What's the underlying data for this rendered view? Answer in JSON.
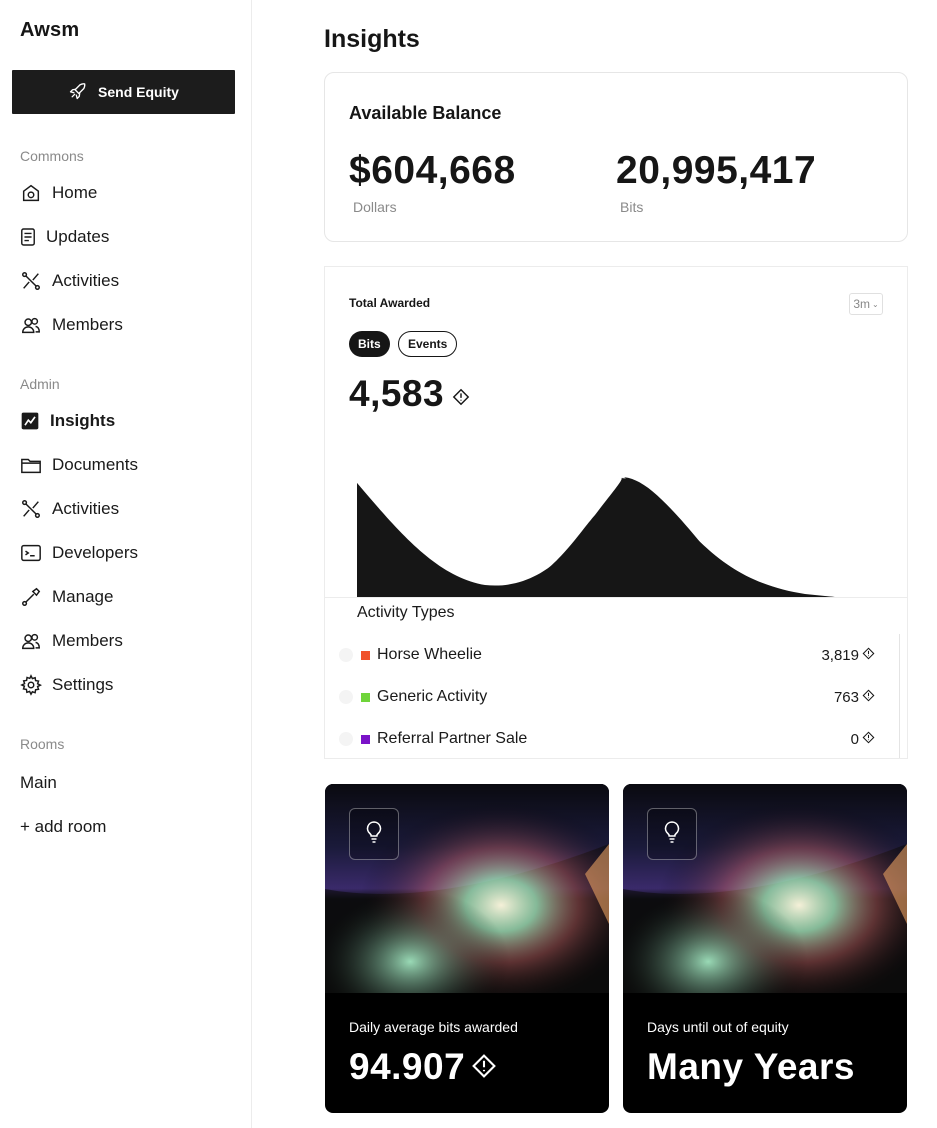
{
  "app": {
    "brand": "Awsm",
    "send_button_label": "Send Equity"
  },
  "sidebar": {
    "commons_label": "Commons",
    "commons_items": [
      {
        "label": "Home",
        "icon": "home-icon"
      },
      {
        "label": "Updates",
        "icon": "document-icon"
      },
      {
        "label": "Activities",
        "icon": "activities-icon"
      },
      {
        "label": "Members",
        "icon": "members-icon"
      }
    ],
    "admin_label": "Admin",
    "admin_items": [
      {
        "label": "Insights",
        "icon": "chart-icon",
        "active": true
      },
      {
        "label": "Documents",
        "icon": "folder-icon"
      },
      {
        "label": "Activities",
        "icon": "activities-icon"
      },
      {
        "label": "Developers",
        "icon": "terminal-icon"
      },
      {
        "label": "Manage",
        "icon": "wrench-icon"
      },
      {
        "label": "Members",
        "icon": "members-icon"
      },
      {
        "label": "Settings",
        "icon": "gear-icon"
      }
    ],
    "rooms_label": "Rooms",
    "rooms": [
      "Main"
    ],
    "add_room_label": "+ add room"
  },
  "main": {
    "title": "Insights",
    "balance": {
      "title": "Available Balance",
      "dollars_value": "$604,668",
      "dollars_label": "Dollars",
      "bits_value": "20,995,417",
      "bits_label": "Bits"
    },
    "awarded": {
      "title": "Total Awarded",
      "range": "3m",
      "tabs": [
        "Bits",
        "Events"
      ],
      "active_tab": "Bits",
      "total": "4,583",
      "legend_title": "Activity Types",
      "activities": [
        {
          "name": "Horse Wheelie",
          "value": "3,819",
          "color": "#f0522a"
        },
        {
          "name": "Generic Activity",
          "value": "763",
          "color": "#6fd43a"
        },
        {
          "name": "Referral Partner Sale",
          "value": "0",
          "color": "#7a12c8"
        }
      ]
    },
    "stats": [
      {
        "label": "Daily average bits awarded",
        "value": "94.907",
        "icon": "lightbulb-icon",
        "has_bits_icon": true
      },
      {
        "label": "Days until out of equity",
        "value": "Many Years",
        "icon": "lightbulb-icon",
        "has_bits_icon": false
      }
    ]
  },
  "colors": {
    "accent_dark": "#161616",
    "muted": "#8a8a8a",
    "border": "#e6e6e6"
  }
}
